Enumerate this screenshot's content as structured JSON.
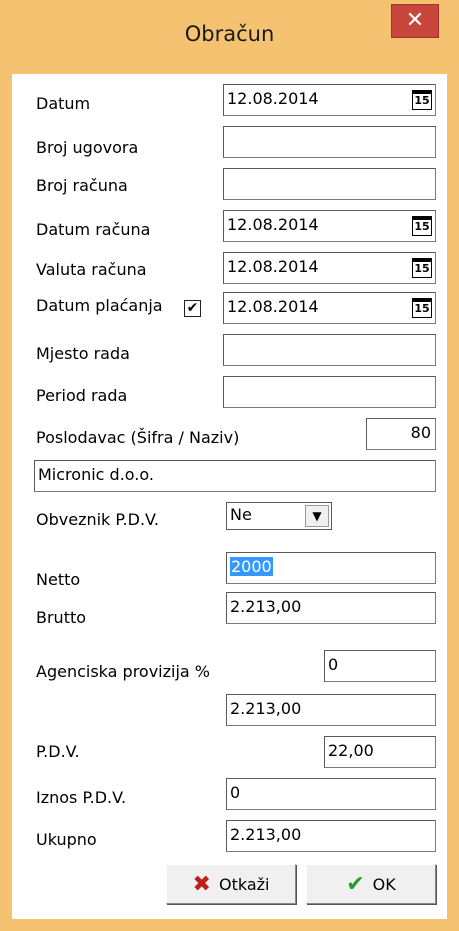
{
  "window": {
    "title": "Obračun",
    "close_glyph": "✕"
  },
  "icons": {
    "calendar": "15",
    "check": "✔",
    "dropdown": "▼"
  },
  "labels": {
    "datum": "Datum",
    "broj_ugovora": "Broj ugovora",
    "broj_racuna": "Broj računa",
    "datum_racuna": "Datum računa",
    "valuta_racuna": "Valuta računa",
    "datum_placanja": "Datum plaćanja",
    "mjesto_rada": "Mjesto rada",
    "period_rada": "Period rada",
    "poslodavac": "Poslodavac (Šifra / Naziv)",
    "obveznik_pdv": "Obveznik P.D.V.",
    "netto": "Netto",
    "brutto": "Brutto",
    "agencijska_provizija": "Agenciska provizija %",
    "pdv": "P.D.V.",
    "iznos_pdv": "Iznos P.D.V.",
    "ukupno": "Ukupno"
  },
  "values": {
    "datum": "12.08.2014",
    "broj_ugovora": "",
    "broj_racuna": "",
    "datum_racuna": "12.08.2014",
    "valuta_racuna": "12.08.2014",
    "datum_placanja": "12.08.2014",
    "datum_placanja_checked": true,
    "mjesto_rada": "",
    "period_rada": "",
    "poslodavac_sifra": "80",
    "poslodavac_naziv": "Micronic d.o.o.",
    "obveznik_pdv": "Ne",
    "netto": "2000",
    "brutto": "2.213,00",
    "agencijska_provizija": "0",
    "provizija_iznos": "2.213,00",
    "pdv": "22,00",
    "iznos_pdv": "0",
    "ukupno": "2.213,00"
  },
  "buttons": {
    "cancel": "Otkaži",
    "ok": "OK"
  },
  "colors": {
    "frame": "#f4c270",
    "close": "#c9463d",
    "selection": "#3399ff",
    "cancel_icon": "#c0201a",
    "ok_icon": "#2a9a2a"
  }
}
